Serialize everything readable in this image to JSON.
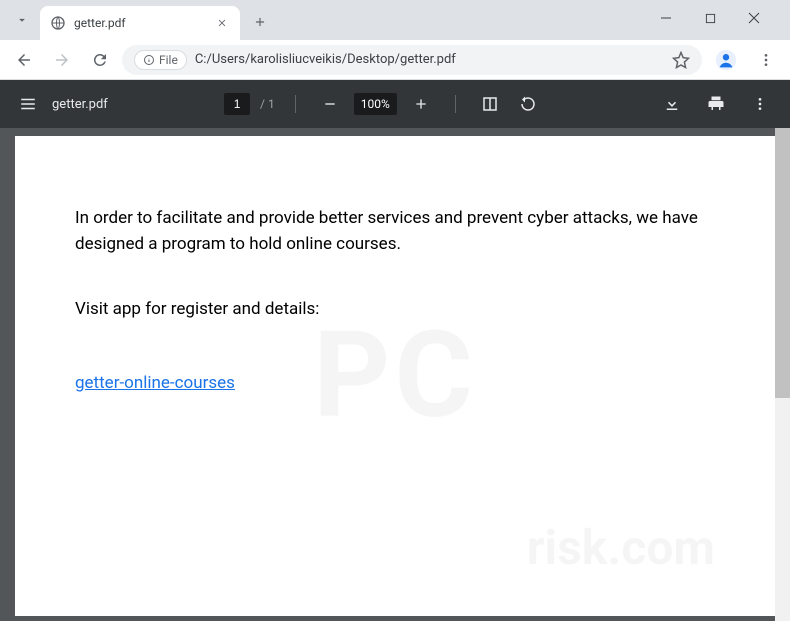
{
  "browser": {
    "tab_title": "getter.pdf",
    "file_chip": "File",
    "url": "C:/Users/karolisliucveikis/Desktop/getter.pdf"
  },
  "pdf_toolbar": {
    "filename": "getter.pdf",
    "current_page": "1",
    "total_pages": "/  1",
    "zoom": "100%"
  },
  "pdf_content": {
    "paragraph1": "In order to facilitate and provide better services and prevent cyber attacks, we have designed a program to hold online courses.",
    "paragraph2": "Visit app for register and details:",
    "link_text": "getter-online-courses"
  },
  "watermark": {
    "main": "PC",
    "sub": "risk.com"
  }
}
